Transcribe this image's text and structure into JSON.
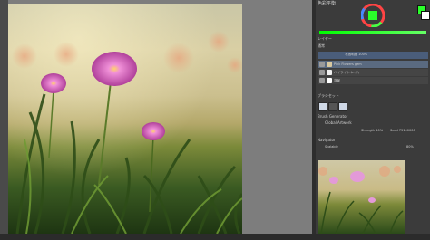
{
  "canvas": {
    "description_alt": ""
  },
  "color_panel": {
    "title": "色彩平衡",
    "fg_color": "#2aff2a",
    "bg_color": "#ffffff"
  },
  "layer_panel": {
    "title": "レイヤー",
    "blend_mode": "通常",
    "opacity_label": "不透明度 100%",
    "layers": [
      {
        "name": "Pink Flowers gem",
        "selected": true
      },
      {
        "name": "ハイライト:レイヤー",
        "selected": false
      },
      {
        "name": "背景",
        "selected": false
      }
    ]
  },
  "brush_panel": {
    "title": "ブラシセット",
    "brush_label": "Brush Generator",
    "brush_name": "Global Artwork",
    "strength_label": "Strength 40%",
    "seed_label": "Seed 75100000"
  },
  "navigator": {
    "title": "Navigator",
    "zoom_label": "Scalable",
    "zoom_percent": "80%"
  },
  "accent": "#6e87b0"
}
